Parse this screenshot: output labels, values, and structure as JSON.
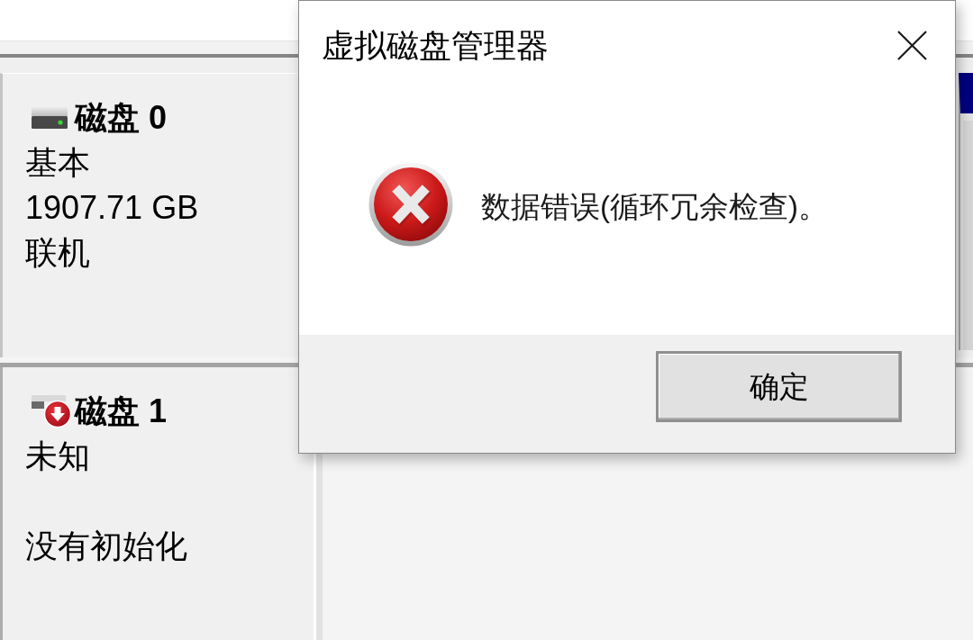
{
  "disks": [
    {
      "kind": "online",
      "name": "磁盘 0",
      "type": "基本",
      "size": "1907.71 GB",
      "state": "联机"
    },
    {
      "kind": "error",
      "name": "磁盘 1",
      "type": "未知",
      "state": "没有初始化"
    }
  ],
  "dialog": {
    "title": "虚拟磁盘管理器",
    "message": "数据错误(循环冗余检查)。",
    "buttons": [
      "确定"
    ]
  }
}
